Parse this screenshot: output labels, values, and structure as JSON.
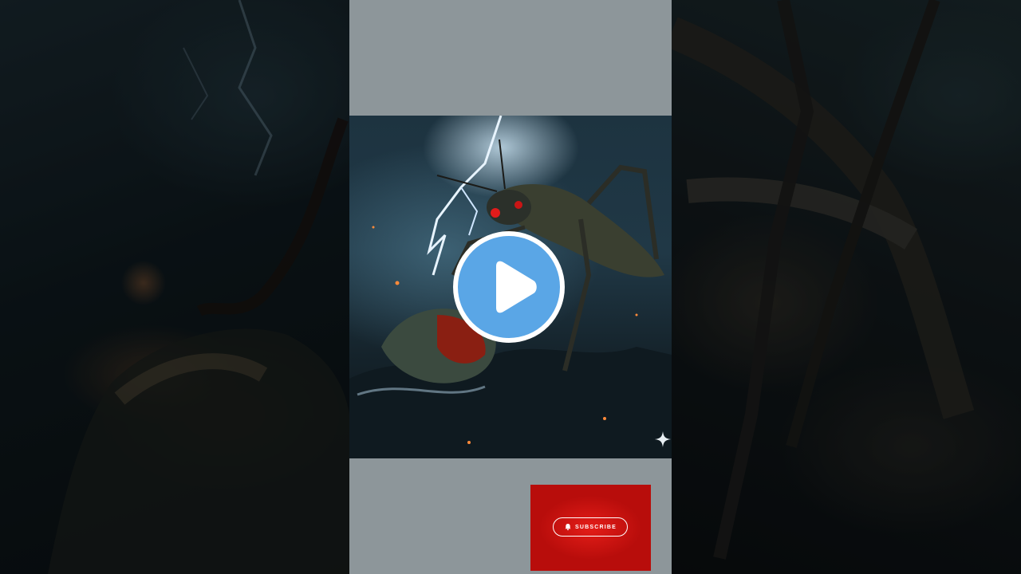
{
  "player": {
    "play_icon": "play-icon",
    "play_color": "#5aa6e6",
    "background_color": "#8d969a"
  },
  "overlay": {
    "sparkle_icon": "sparkle-icon"
  },
  "subscribe": {
    "label": "SUBSCRIBE",
    "icon": "bell-icon",
    "card_color": "#d81412"
  }
}
